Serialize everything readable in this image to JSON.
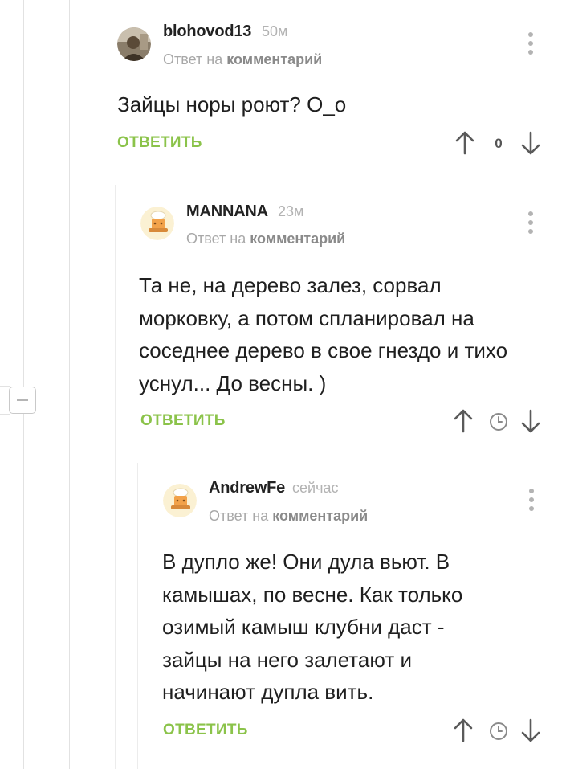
{
  "collapse": {
    "icon": "minus-icon"
  },
  "comments": [
    {
      "username": "blohovod13",
      "time": "50м",
      "reply_prefix": "Ответ на",
      "reply_link": "комментарий",
      "text": "Зайцы норы роют? О_о",
      "reply_label": "ОТВЕТИТЬ",
      "score": "0",
      "avatar": "user-photo-avatar"
    },
    {
      "username": "MANNANA",
      "time": "23м",
      "reply_prefix": "Ответ на",
      "reply_link": "комментарий",
      "text": "Та не, на дерево залез, сорвал морковку, а потом спланировал на соседнее дерево в свое гнездо и тихо уснул... До весны. )",
      "reply_label": "ОТВЕТИТЬ",
      "avatar": "default-chef-avatar"
    },
    {
      "username": "AndrewFe",
      "time": "сейчас",
      "reply_prefix": "Ответ на",
      "reply_link": "комментарий",
      "text": "В дупло же! Они дула вьют. В камышах, по весне. Как только озимый камыш клубни даст - зайцы на него залетают и начинают дупла вить.",
      "reply_label": "ОТВЕТИТЬ",
      "avatar": "default-chef-avatar"
    }
  ],
  "colors": {
    "accent_green": "#8bc34a",
    "muted": "#b3b3b3",
    "thread_line": "#e2e2e2"
  }
}
